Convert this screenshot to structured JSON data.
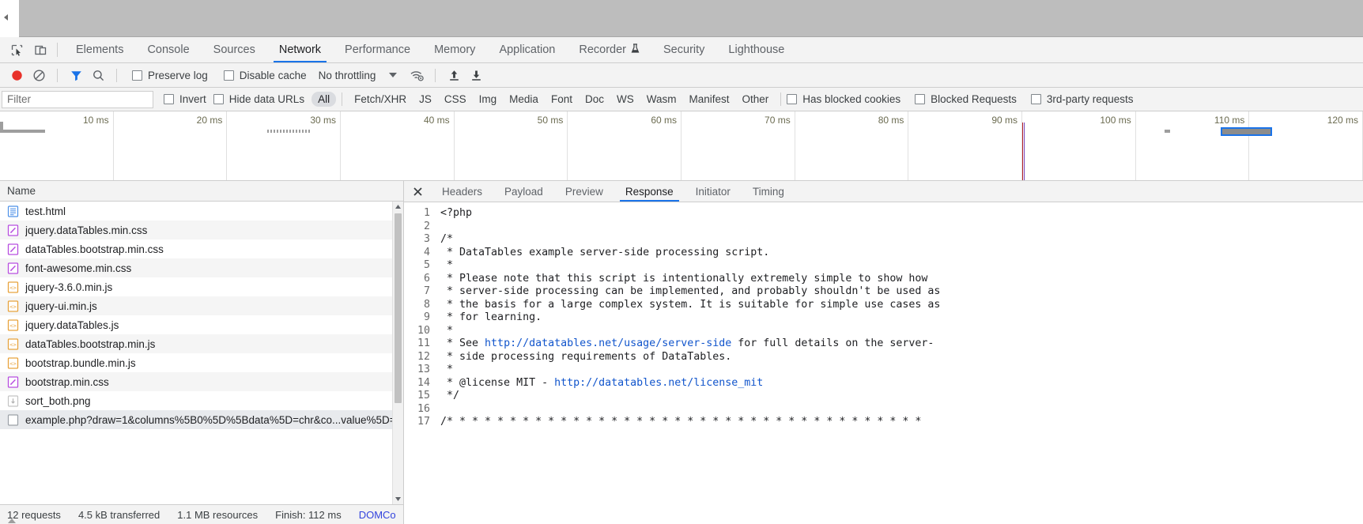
{
  "window": {
    "back_arrow": "back-arrow"
  },
  "main_tabs": {
    "inspect_icon": "inspect-element-icon",
    "device_icon": "device-toolbar-icon",
    "items": [
      {
        "label": "Elements",
        "active": false
      },
      {
        "label": "Console",
        "active": false
      },
      {
        "label": "Sources",
        "active": false
      },
      {
        "label": "Network",
        "active": true
      },
      {
        "label": "Performance",
        "active": false
      },
      {
        "label": "Memory",
        "active": false
      },
      {
        "label": "Application",
        "active": false
      },
      {
        "label": "Recorder",
        "active": false,
        "badge": "experiment-beaker-icon"
      },
      {
        "label": "Security",
        "active": false
      },
      {
        "label": "Lighthouse",
        "active": false
      }
    ]
  },
  "controls": {
    "record_label": "record-button",
    "record_color": "#e8312a",
    "clear_label": "clear-button",
    "filter_icon_label": "filter-icon",
    "filter_icon_color": "#1a73e8",
    "search_label": "search-button",
    "preserve_log": "Preserve log",
    "disable_cache": "Disable cache",
    "throttling": "No throttling",
    "wifi_label": "network-conditions-icon",
    "import_label": "import-har-icon",
    "export_label": "export-har-icon"
  },
  "filters": {
    "placeholder": "Filter",
    "value": "",
    "invert": "Invert",
    "hide_data_urls": "Hide data URLs",
    "types": [
      {
        "label": "All",
        "active": true
      },
      {
        "label": "Fetch/XHR",
        "active": false
      },
      {
        "label": "JS",
        "active": false
      },
      {
        "label": "CSS",
        "active": false
      },
      {
        "label": "Img",
        "active": false
      },
      {
        "label": "Media",
        "active": false
      },
      {
        "label": "Font",
        "active": false
      },
      {
        "label": "Doc",
        "active": false
      },
      {
        "label": "WS",
        "active": false
      },
      {
        "label": "Wasm",
        "active": false
      },
      {
        "label": "Manifest",
        "active": false
      },
      {
        "label": "Other",
        "active": false
      }
    ],
    "has_blocked_cookies": "Has blocked cookies",
    "blocked_requests": "Blocked Requests",
    "third_party_requests": "3rd-party requests"
  },
  "overview": {
    "ticks": [
      "10 ms",
      "20 ms",
      "30 ms",
      "40 ms",
      "50 ms",
      "60 ms",
      "70 ms",
      "80 ms",
      "90 ms",
      "100 ms",
      "110 ms",
      "120 ms"
    ],
    "dom_content_loaded_ms": 90,
    "dom_content_loaded_color": "#b2202a",
    "load_color": "#7744bb",
    "selected_bar_color": "#1a73e8",
    "bars": [
      {
        "start_ms": 0.3,
        "end_ms": 4.0,
        "style": "solid"
      },
      {
        "start_ms": 23.5,
        "end_ms": 27.3,
        "style": "dotted"
      },
      {
        "start_ms": 102.5,
        "end_ms": 103.0,
        "style": "solid"
      },
      {
        "start_ms": 107.5,
        "end_ms": 112.0,
        "style": "selected"
      }
    ]
  },
  "request_list": {
    "column_header": "Name",
    "rows": [
      {
        "name": "test.html",
        "icon": "document-icon"
      },
      {
        "name": "jquery.dataTables.min.css",
        "icon": "stylesheet-icon"
      },
      {
        "name": "dataTables.bootstrap.min.css",
        "icon": "stylesheet-icon"
      },
      {
        "name": "font-awesome.min.css",
        "icon": "stylesheet-icon"
      },
      {
        "name": "jquery-3.6.0.min.js",
        "icon": "script-icon"
      },
      {
        "name": "jquery-ui.min.js",
        "icon": "script-icon"
      },
      {
        "name": "jquery.dataTables.js",
        "icon": "script-icon"
      },
      {
        "name": "dataTables.bootstrap.min.js",
        "icon": "script-icon"
      },
      {
        "name": "bootstrap.bundle.min.js",
        "icon": "script-icon"
      },
      {
        "name": "bootstrap.min.css",
        "icon": "stylesheet-icon"
      },
      {
        "name": "sort_both.png",
        "icon": "image-icon"
      },
      {
        "name": "example.php?draw=1&columns%5B0%5D%5Bdata%5D=chr&co...value%5D=",
        "icon": "generic-icon",
        "selected": true
      }
    ]
  },
  "status_bar": {
    "requests": "12 requests",
    "transferred": "4.5 kB transferred",
    "resources": "1.1 MB resources",
    "finish": "Finish: 112 ms",
    "dom_content_loaded": "DOMCo"
  },
  "detail": {
    "close_icon": "close-icon",
    "tabs": [
      {
        "label": "Headers",
        "active": false
      },
      {
        "label": "Payload",
        "active": false
      },
      {
        "label": "Preview",
        "active": false
      },
      {
        "label": "Response",
        "active": true
      },
      {
        "label": "Initiator",
        "active": false
      },
      {
        "label": "Timing",
        "active": false
      }
    ],
    "code_lines": [
      {
        "n": "1",
        "text": "<?php"
      },
      {
        "n": "2",
        "text": ""
      },
      {
        "n": "3",
        "text": "/*"
      },
      {
        "n": "4",
        "text": " * DataTables example server-side processing script."
      },
      {
        "n": "5",
        "text": " *"
      },
      {
        "n": "6",
        "text": " * Please note that this script is intentionally extremely simple to show how"
      },
      {
        "n": "7",
        "text": " * server-side processing can be implemented, and probably shouldn't be used as"
      },
      {
        "n": "8",
        "text": " * the basis for a large complex system. It is suitable for simple use cases as"
      },
      {
        "n": "9",
        "text": " * for learning."
      },
      {
        "n": "10",
        "text": " *"
      },
      {
        "n": "11",
        "text": " * See http://datatables.net/usage/server-side for full details on the server-",
        "link": "http://datatables.net/usage/server-side"
      },
      {
        "n": "12",
        "text": " * side processing requirements of DataTables."
      },
      {
        "n": "13",
        "text": " *"
      },
      {
        "n": "14",
        "text": " * @license MIT - http://datatables.net/license_mit",
        "link": "http://datatables.net/license_mit"
      },
      {
        "n": "15",
        "text": " */"
      },
      {
        "n": "16",
        "text": ""
      },
      {
        "n": "17",
        "text": "/* * * * * * * * * * * * * * * * * * * * * * * * * * * * * * * * * * * * * *"
      }
    ]
  }
}
